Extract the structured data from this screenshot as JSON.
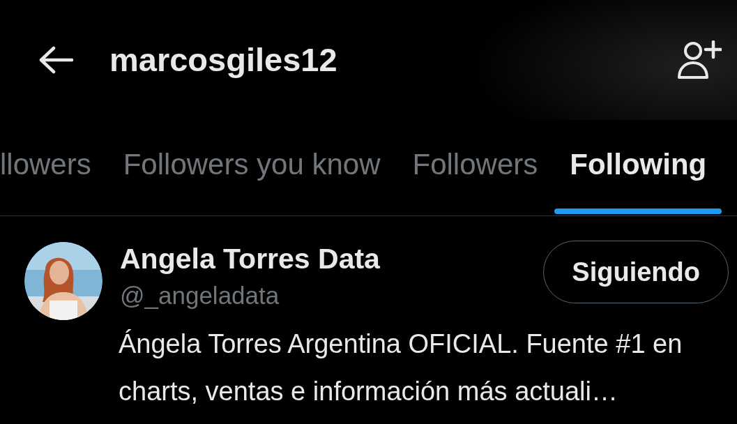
{
  "header": {
    "title": "marcosgiles12"
  },
  "tabs": [
    {
      "label": "llowers",
      "selected": false
    },
    {
      "label": "Followers you know",
      "selected": false
    },
    {
      "label": "Followers",
      "selected": false
    },
    {
      "label": "Following",
      "selected": true
    }
  ],
  "users": [
    {
      "name": "Angela Torres Data",
      "handle": "@_angeladata",
      "button": "Siguiendo",
      "bio": "Ángela Torres Argentina OFICIAL. Fuente #1 en charts, ventas e información más actuali…"
    }
  ]
}
